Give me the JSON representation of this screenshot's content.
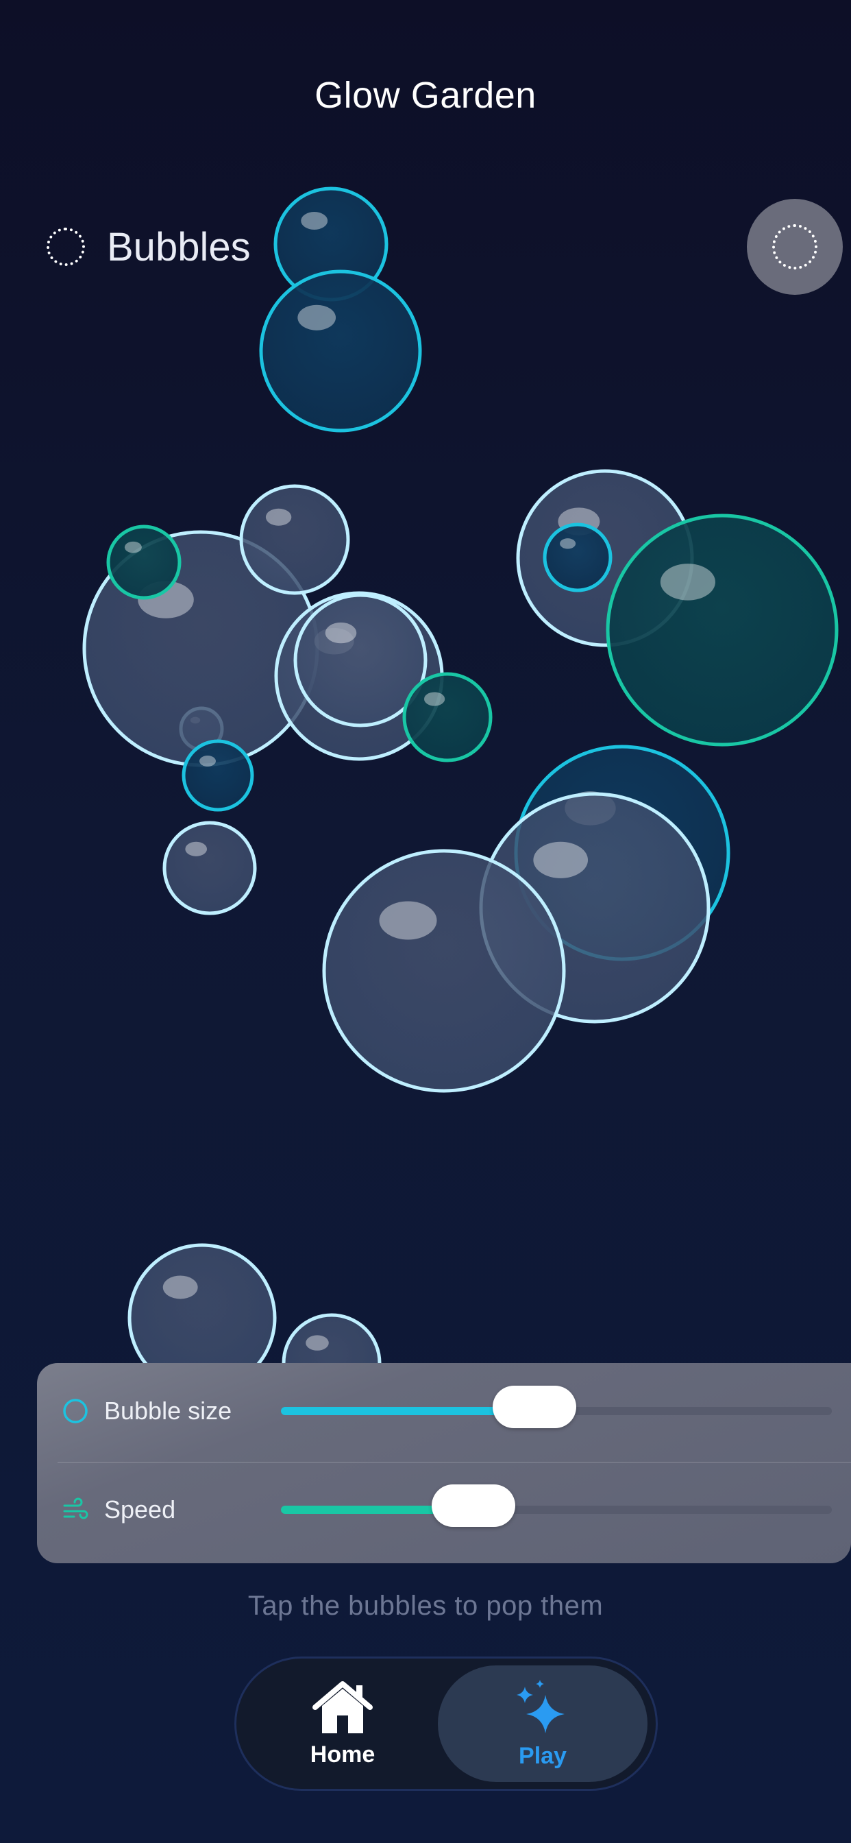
{
  "header": {
    "title": "Glow Garden"
  },
  "mode": {
    "label": "Bubbles",
    "icon": "dotted-circle-icon"
  },
  "top_action": {
    "icon": "dotted-circle-icon"
  },
  "controls": {
    "bubble_size": {
      "label": "Bubble size",
      "icon": "circle-outline-icon",
      "value_fraction": 0.46,
      "accent": "#1cc3e0"
    },
    "speed": {
      "label": "Speed",
      "icon": "wind-icon",
      "value_fraction": 0.35,
      "accent": "#19c7a5"
    }
  },
  "hint": "Tap the bubbles to pop them",
  "tabbar": {
    "tabs": [
      {
        "label": "Home",
        "icon": "house-icon",
        "selected": false
      },
      {
        "label": "Play",
        "icon": "sparkles-icon",
        "selected": true
      }
    ]
  },
  "colors": {
    "background_top": "#0d0f27",
    "background_bottom": "#0e1a3a",
    "bubble_white": "#bfefff",
    "bubble_cyan": "#1cc3e0",
    "bubble_teal": "#19c7a5",
    "active_tab": "#2a9bf2"
  }
}
